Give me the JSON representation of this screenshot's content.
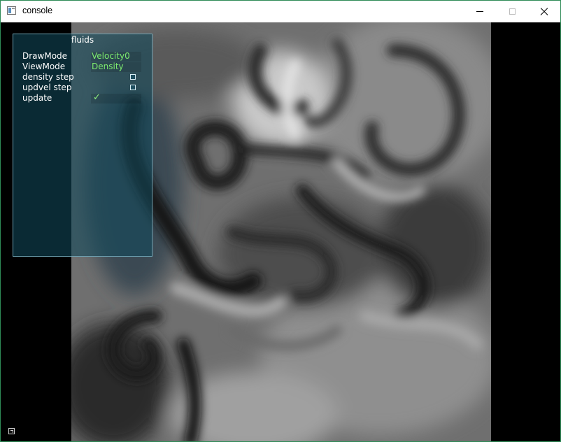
{
  "window": {
    "title": "console",
    "icon": "app-window-icon",
    "controls": {
      "minimize_icon": "minimize-icon",
      "maximize_icon": "maximize-icon",
      "close_icon": "close-icon"
    }
  },
  "panel": {
    "title": "fluids",
    "rows": [
      {
        "label": "DrawMode",
        "value": "Velocity0",
        "type": "option"
      },
      {
        "label": "ViewMode",
        "value": "Density",
        "type": "option"
      },
      {
        "label": "density step",
        "checked": false,
        "type": "checkbox"
      },
      {
        "label": "updvel step",
        "checked": false,
        "type": "checkbox"
      },
      {
        "label": "update",
        "checked": true,
        "type": "checkbox"
      }
    ],
    "value_color": "#7dec6f",
    "panel_color": "#12485a"
  },
  "simulation": {
    "view": "density field (grayscale)"
  },
  "corner_icon": "resize-icon"
}
